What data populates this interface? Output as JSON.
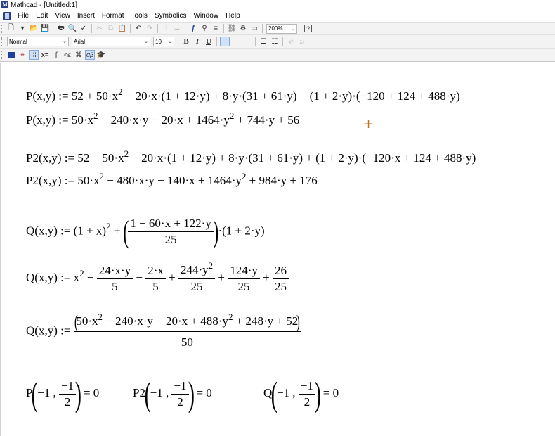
{
  "window": {
    "title": "Mathcad - [Untitled:1]",
    "app_icon": "M"
  },
  "menu": [
    "File",
    "Edit",
    "View",
    "Insert",
    "Format",
    "Tools",
    "Symbolics",
    "Window",
    "Help"
  ],
  "toolbar2": {
    "style": "Normal",
    "font": "Arial",
    "size": "10"
  },
  "toolbar1": {
    "zoom": "200%"
  },
  "eq": {
    "p_def": "P(x,y) := 52 + 50·x",
    "p_def_sup": "2",
    "p_def_rest": " − 20·x·(1 + 12·y) + 8·y·(31 + 61·y) + (1 + 2·y)·(−120 + 124 + 488·y)",
    "p_exp_a": "P(x,y) := 50·x",
    "p_exp_sup1": "2",
    "p_exp_b": " − 240·x·y − 20·x + 1464·y",
    "p_exp_sup2": "2",
    "p_exp_c": " + 744·y + 56",
    "p2_def": "P2(x,y) := 52 + 50·x",
    "p2_def_sup": "2",
    "p2_def_rest": " − 20·x·(1 + 12·y) + 8·y·(31 + 61·y) + (1 + 2·y)·(−120·x + 124 + 488·y)",
    "p2_exp_a": "P2(x,y) := 50·x",
    "p2_exp_sup1": "2",
    "p2_exp_b": " − 480·x·y − 140·x + 1464·y",
    "p2_exp_sup2": "2",
    "p2_exp_c": " + 984·y + 176",
    "q_def_a": "Q(x,y) := (1 + x)",
    "q_def_sup": "2",
    "q_def_plus": " + ",
    "q_def_num": "1 − 60·x + 122·y",
    "q_def_den": "25",
    "q_def_tail": "·(1 + 2·y)",
    "q_exp_a": "Q(x,y) := x",
    "q_exp_sup": "2",
    "q_exp_m1": " − ",
    "q_exp_f1n": "24·x·y",
    "q_exp_f1d": "5",
    "q_exp_m2": " − ",
    "q_exp_f2n": "2·x",
    "q_exp_f2d": "5",
    "q_exp_p3": " + ",
    "q_exp_f3n_a": "244·y",
    "q_exp_f3n_sup": "2",
    "q_exp_f3d": "25",
    "q_exp_p4": " + ",
    "q_exp_f4n": "124·y",
    "q_exp_f4d": "25",
    "q_exp_p5": " + ",
    "q_exp_f5n": "26",
    "q_exp_f5d": "25",
    "q_simp_a": "Q(x,y) := ",
    "q_simp_num_a": "50·x",
    "q_simp_num_sup1": "2",
    "q_simp_num_b": " − 240·x·y − 20·x + 488·y",
    "q_simp_num_sup2": "2",
    "q_simp_num_c": " + 248·y + 52",
    "q_simp_den": "50",
    "eval_p_name": "P",
    "eval_p2_name": "P2",
    "eval_q_name": "Q",
    "eval_arg1": "−1 , ",
    "eval_frac_num": "−1",
    "eval_frac_den": "2",
    "eval_result": " = 0"
  }
}
